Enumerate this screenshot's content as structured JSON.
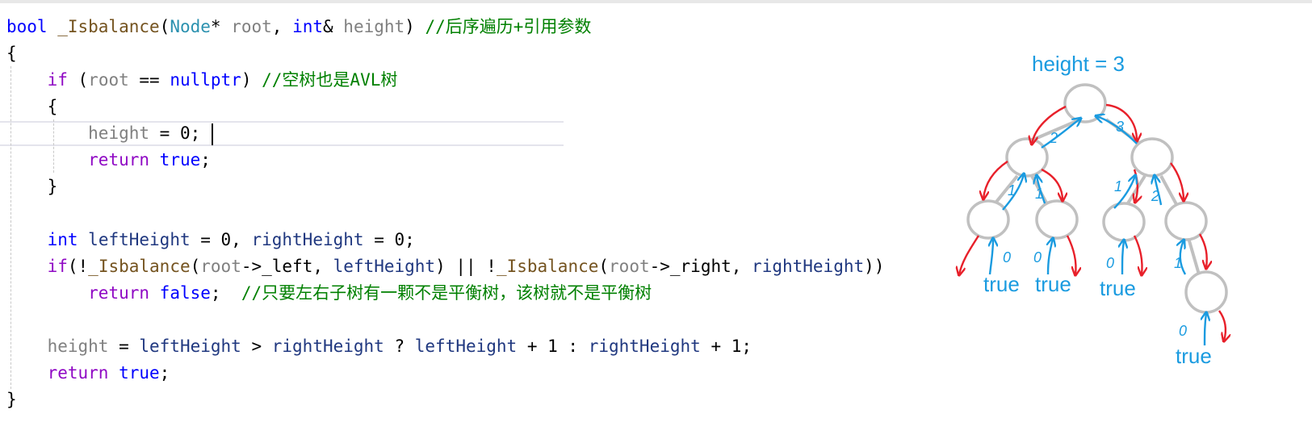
{
  "code": {
    "lines": [
      [
        [
          "bool ",
          "kw"
        ],
        [
          "_Isbalance",
          "fn"
        ],
        [
          "(",
          "pu"
        ],
        [
          "Node",
          "ty"
        ],
        [
          "* ",
          "pu"
        ],
        [
          "root",
          "pa"
        ],
        [
          ", ",
          "pu"
        ],
        [
          "int",
          "kw"
        ],
        [
          "& ",
          "pu"
        ],
        [
          "height",
          "pa"
        ],
        [
          ") ",
          "pu"
        ],
        [
          "//后序遍历+引用参数",
          "ct"
        ]
      ],
      [
        [
          "{",
          "pu"
        ]
      ],
      [
        [
          "    ",
          "pu"
        ],
        [
          "if",
          "fl"
        ],
        [
          " (",
          "pu"
        ],
        [
          "root",
          "pa"
        ],
        [
          " == ",
          "pu"
        ],
        [
          "nullptr",
          "kw"
        ],
        [
          ") ",
          "pu"
        ],
        [
          "//空树也是AVL树",
          "ct"
        ]
      ],
      [
        [
          "    {",
          "pu"
        ]
      ],
      [
        [
          "        ",
          "pu"
        ],
        [
          "height",
          "pa"
        ],
        [
          " = 0;",
          "pu"
        ]
      ],
      [
        [
          "        ",
          "pu"
        ],
        [
          "return",
          "fl"
        ],
        [
          " ",
          "pu"
        ],
        [
          "true",
          "kw"
        ],
        [
          ";",
          "pu"
        ]
      ],
      [
        [
          "    }",
          "pu"
        ]
      ],
      [
        [
          "",
          "pu"
        ]
      ],
      [
        [
          "    ",
          "pu"
        ],
        [
          "int",
          "kw"
        ],
        [
          " ",
          "pu"
        ],
        [
          "leftHeight",
          "va"
        ],
        [
          " = 0, ",
          "pu"
        ],
        [
          "rightHeight",
          "va"
        ],
        [
          " = 0;",
          "pu"
        ]
      ],
      [
        [
          "    ",
          "pu"
        ],
        [
          "if",
          "fl"
        ],
        [
          "(!",
          "pu"
        ],
        [
          "_Isbalance",
          "fn"
        ],
        [
          "(",
          "pu"
        ],
        [
          "root",
          "pa"
        ],
        [
          "->_left, ",
          "pu"
        ],
        [
          "leftHeight",
          "va"
        ],
        [
          ") || !",
          "pu"
        ],
        [
          "_Isbalance",
          "fn"
        ],
        [
          "(",
          "pu"
        ],
        [
          "root",
          "pa"
        ],
        [
          "->_right, ",
          "pu"
        ],
        [
          "rightHeight",
          "va"
        ],
        [
          "))",
          "pu"
        ]
      ],
      [
        [
          "        ",
          "pu"
        ],
        [
          "return",
          "fl"
        ],
        [
          " ",
          "pu"
        ],
        [
          "false",
          "kw"
        ],
        [
          ";  ",
          "pu"
        ],
        [
          "//只要左右子树有一颗不是平衡树，该树就不是平衡树",
          "ct"
        ]
      ],
      [
        [
          "",
          "pu"
        ]
      ],
      [
        [
          "    ",
          "pu"
        ],
        [
          "height",
          "pa"
        ],
        [
          " = ",
          "pu"
        ],
        [
          "leftHeight",
          "va"
        ],
        [
          " > ",
          "pu"
        ],
        [
          "rightHeight",
          "va"
        ],
        [
          " ? ",
          "pu"
        ],
        [
          "leftHeight",
          "va"
        ],
        [
          " + 1 : ",
          "pu"
        ],
        [
          "rightHeight",
          "va"
        ],
        [
          " + 1;",
          "pu"
        ]
      ],
      [
        [
          "    ",
          "pu"
        ],
        [
          "return",
          "fl"
        ],
        [
          " ",
          "pu"
        ],
        [
          "true",
          "kw"
        ],
        [
          ";",
          "pu"
        ]
      ],
      [
        [
          "}",
          "pu"
        ]
      ]
    ]
  },
  "diagram": {
    "height_label": "height = 3",
    "leaf_labels": [
      "true",
      "true",
      "true",
      "true"
    ],
    "edge_numbers": [
      "2",
      "3",
      "1",
      "1",
      "1",
      "2",
      "1"
    ],
    "leaf_numbers": [
      "0",
      "0",
      "0",
      "0"
    ],
    "colors": {
      "up_arrow": "#1a9be0",
      "down_arrow": "#e8202a",
      "node": "#c0c0c0",
      "label": "#1a9be0"
    }
  }
}
